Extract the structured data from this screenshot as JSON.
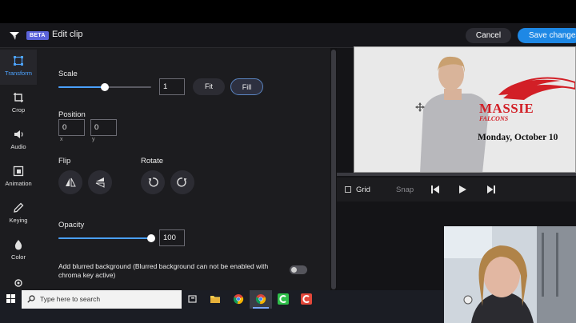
{
  "header": {
    "beta_label": "BETA",
    "title": "Edit clip",
    "cancel_label": "Cancel",
    "save_label": "Save changes"
  },
  "sidebar": {
    "items": [
      {
        "label": "Transform",
        "icon": "crop-frame-icon",
        "active": true
      },
      {
        "label": "Crop",
        "icon": "crop-icon",
        "active": false
      },
      {
        "label": "Audio",
        "icon": "speaker-icon",
        "active": false
      },
      {
        "label": "Animation",
        "icon": "animation-icon",
        "active": false
      },
      {
        "label": "Keying",
        "icon": "eyedropper-icon",
        "active": false
      },
      {
        "label": "Color",
        "icon": "droplet-icon",
        "active": false
      }
    ]
  },
  "transform": {
    "scale_label": "Scale",
    "scale_value": "1",
    "scale_fraction": 0.5,
    "fit_label": "Fit",
    "fill_label": "Fill",
    "position_label": "Position",
    "pos_x_value": "0",
    "pos_y_value": "0",
    "pos_x_sub": "x",
    "pos_y_sub": "y",
    "flip_label": "Flip",
    "rotate_label": "Rotate",
    "opacity_label": "Opacity",
    "opacity_value": "100",
    "opacity_fraction": 1.0,
    "blur_label": "Add blurred background (Blurred background can not be enabled with chroma key active)"
  },
  "preview": {
    "logo_text": "MASSIE",
    "logo_subtext": "FALCONS",
    "date_text": "Monday, October 10"
  },
  "controls": {
    "grid_label": "Grid",
    "snap_label": "Snap"
  },
  "taskbar": {
    "search_placeholder": "Type here to search"
  },
  "colors": {
    "accent": "#1e88e5",
    "active_tab": "#4da3ff",
    "logo_red": "#d21f26"
  }
}
